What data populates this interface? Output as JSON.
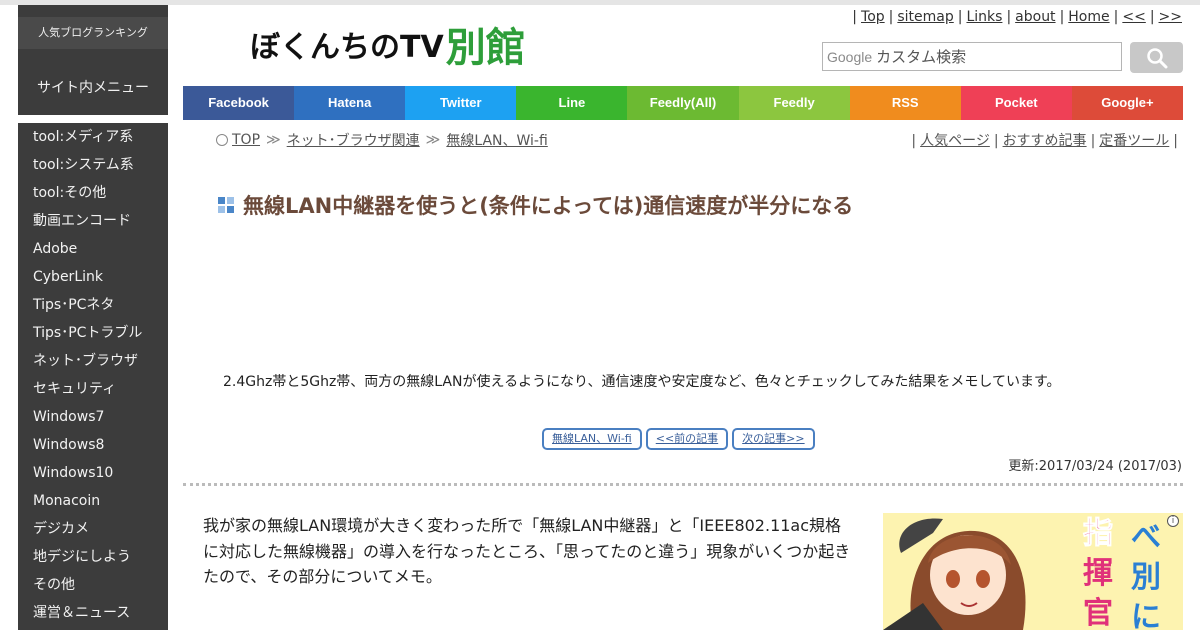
{
  "sidebar": {
    "ranking_label": "人気ブログランキング",
    "menu_title": "サイト内メニュー",
    "items": [
      "tool:メディア系",
      "tool:システム系",
      "tool:その他",
      "動画エンコード",
      "Adobe",
      "CyberLink",
      "Tips･PCネタ",
      "Tips･PCトラブル",
      "ネット･ブラウザ",
      "セキュリティ",
      "Windows7",
      "Windows8",
      "Windows10",
      "Monacoin",
      "デジカメ",
      "地デジにしよう",
      "その他",
      "運営＆ニュース"
    ]
  },
  "header": {
    "logo_main": "ぼくんちのTV",
    "logo_accent": "別館",
    "top_links": [
      "Top",
      "sitemap",
      "Links",
      "about",
      "Home",
      "<<",
      ">>"
    ],
    "search_brand": "Google",
    "search_placeholder": "カスタム検索",
    "search_icon": "magnifier-icon"
  },
  "social": [
    {
      "label": "Facebook",
      "color": "#3b5998"
    },
    {
      "label": "Hatena",
      "color": "#2f70c0"
    },
    {
      "label": "Twitter",
      "color": "#1da1f2"
    },
    {
      "label": "Line",
      "color": "#3ab52e"
    },
    {
      "label": "Feedly(All)",
      "color": "#6cba32"
    },
    {
      "label": "Feedly",
      "color": "#8cc63f"
    },
    {
      "label": "RSS",
      "color": "#f08c1e"
    },
    {
      "label": "Pocket",
      "color": "#ef4056"
    },
    {
      "label": "Google+",
      "color": "#dd4b39"
    }
  ],
  "breadcrumb": {
    "items": [
      "TOP",
      "ネット･ブラウザ関連",
      "無線LAN、Wi-fi"
    ],
    "separator": "≫"
  },
  "right_links": [
    "人気ページ",
    "おすすめ記事",
    "定番ツール"
  ],
  "article": {
    "title": "無線LAN中継器を使うと(条件によっては)通信速度が半分になる",
    "intro": "2.4Ghz帯と5Ghz帯、両方の無線LANが使えるようになり、通信速度や安定度など、色々とチェックしてみた結果をメモしています。",
    "buttons": [
      "無線LAN、Wi-fi",
      "<<前の記事",
      "次の記事>>"
    ],
    "updated": "更新:2017/03/24 (2017/03)",
    "body": "我が家の無線LAN環境が大きく変わった所で「無線LAN中継器」と「IEEE802.11ac規格に対応した無線機器」の導入を行なったところ、「思ってたのと違う」現象がいくつか起きたので、その部分についてメモ。"
  },
  "ad": {
    "chars_col1": "指揮官",
    "chars_col2": "べ、別に",
    "info_icon": "info-icon"
  }
}
